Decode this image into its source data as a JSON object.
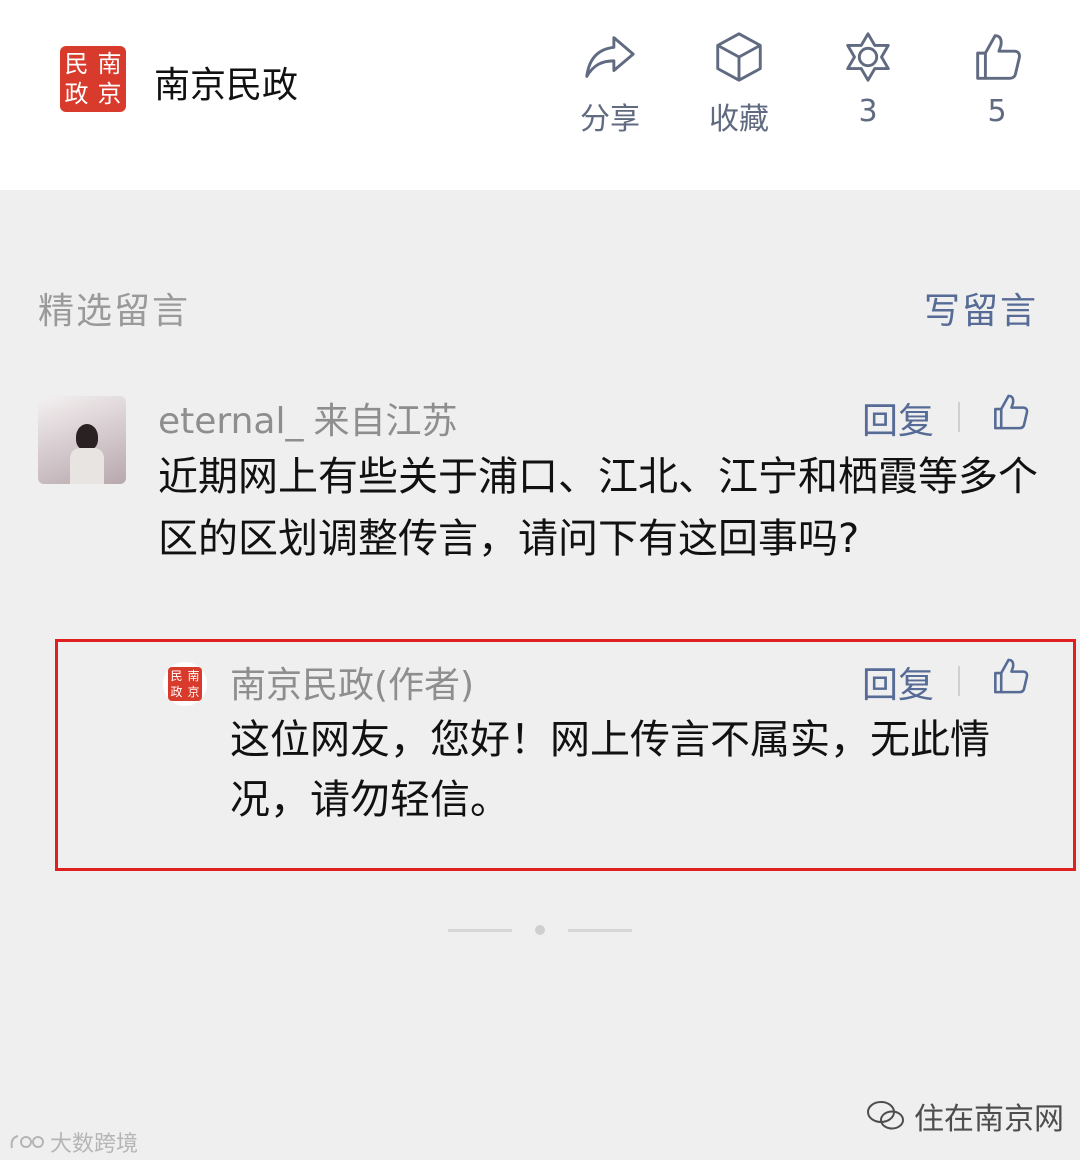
{
  "account": {
    "name": "南京民政",
    "logo_chars": [
      "民",
      "南",
      "政",
      "京"
    ]
  },
  "actions": [
    {
      "icon": "share-icon",
      "label": "分享"
    },
    {
      "icon": "cube-icon",
      "label": "收藏"
    },
    {
      "icon": "star-icon",
      "label": "3"
    },
    {
      "icon": "thumb-up-icon",
      "label": "5"
    }
  ],
  "comments_section": {
    "title": "精选留言",
    "write_label": "写留言"
  },
  "comment": {
    "user": "eternal_",
    "location": "来自江苏",
    "reply_label": "回复",
    "text": "近期网上有些关于浦口、江北、江宁和栖霞等多个区的区划调整传言，请问下有这回事吗?"
  },
  "author_reply": {
    "name": "南京民政(作者)",
    "reply_label": "回复",
    "text": "这位网友，您好！网上传言不属实，无此情况，请勿轻信。"
  },
  "watermarks": {
    "right": "住在南京网",
    "left": "大数跨境"
  },
  "colors": {
    "accent": "#566b95",
    "logo_red": "#d83a2b",
    "highlight_border": "#e02020"
  }
}
